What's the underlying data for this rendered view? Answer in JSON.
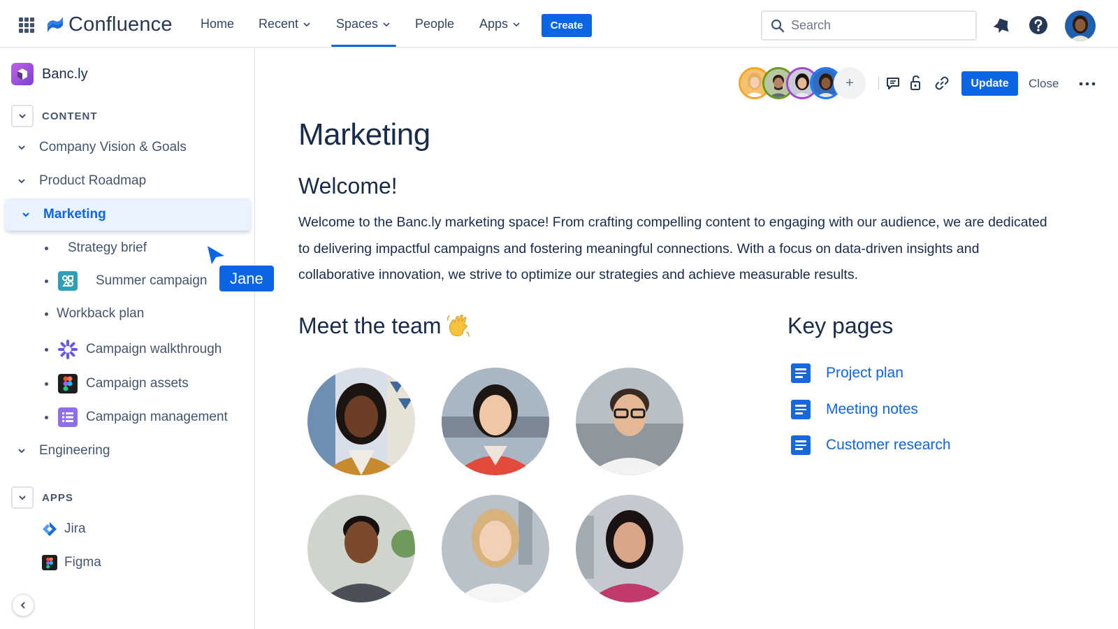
{
  "topnav": {
    "logo_text": "Confluence",
    "items": [
      {
        "label": "Home",
        "has_dropdown": false
      },
      {
        "label": "Recent",
        "has_dropdown": true
      },
      {
        "label": "Spaces",
        "has_dropdown": true,
        "active": true
      },
      {
        "label": "People",
        "has_dropdown": false
      },
      {
        "label": "Apps",
        "has_dropdown": true
      }
    ],
    "create_label": "Create",
    "search_placeholder": "Search",
    "icons": [
      "apps-grid-icon",
      "notifications-icon",
      "help-icon",
      "user-avatar"
    ]
  },
  "sidebar": {
    "space_name": "Banc.ly",
    "content_label": "CONTENT",
    "tree": [
      {
        "label": "Company Vision & Goals"
      },
      {
        "label": "Product Roadmap"
      },
      {
        "label": "Marketing",
        "active": true
      },
      {
        "label": "Engineering"
      }
    ],
    "marketing_children": [
      {
        "label": "Strategy brief",
        "icon": ""
      },
      {
        "label": "Summer campaign",
        "icon": "whiteboard-icon"
      },
      {
        "label": "Workback plan",
        "icon": ""
      },
      {
        "label": "Campaign walkthrough",
        "icon": "loom-icon"
      },
      {
        "label": "Campaign assets",
        "icon": "figma-icon"
      },
      {
        "label": "Campaign management",
        "icon": "database-icon"
      }
    ],
    "apps_label": "APPS",
    "apps": [
      {
        "label": "Jira",
        "icon": "jira-icon"
      },
      {
        "label": "Figma",
        "icon": "figma-icon"
      }
    ]
  },
  "cursor": {
    "label": "Jane"
  },
  "toolbar": {
    "collaborator_count": 4,
    "collaborator_ring_colors": [
      "#f5a623",
      "#6a9a1f",
      "#a347d6",
      "#1d7afc"
    ],
    "update_label": "Update",
    "close_label": "Close",
    "icons": [
      "comment-icon",
      "restrictions-icon",
      "copy-link-icon",
      "more-icon"
    ]
  },
  "page": {
    "title": "Marketing",
    "welcome_heading": "Welcome!",
    "welcome_text": "Welcome to the Banc.ly marketing space! From crafting compelling content to engaging with our audience, we are dedicated to delivering impactful campaigns and fostering meaningful connections. With a focus on data-driven insights and collaborative innovation, we strive to optimize our strategies and achieve measurable results.",
    "team_heading": "Meet the team",
    "team_emoji": "waving-hand-icon",
    "team_members": 6,
    "key_pages_heading": "Key pages",
    "key_pages": [
      "Project plan",
      "Meeting notes",
      "Customer research"
    ]
  },
  "colors": {
    "brand_blue": "#0c66e4",
    "text": "#172b4d",
    "subtle_text": "#44546f",
    "border": "#dfe1e6"
  }
}
